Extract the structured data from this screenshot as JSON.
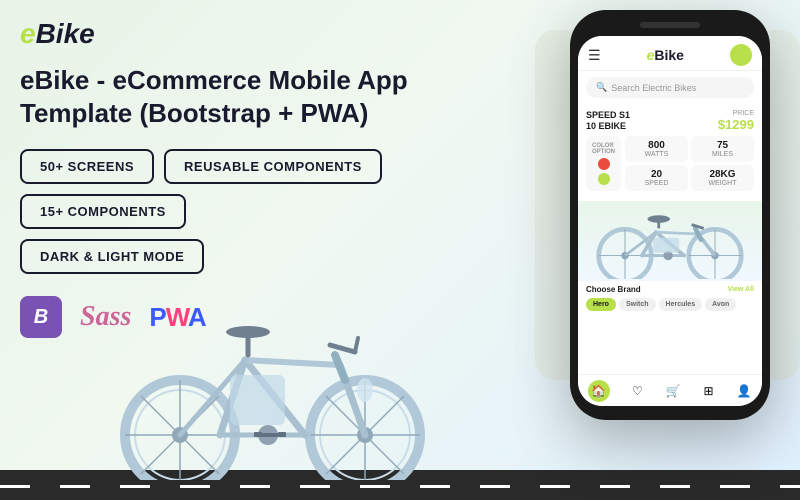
{
  "logo": {
    "e": "e",
    "bike": "Bike"
  },
  "title": "eBike - eCommerce Mobile App Template (Bootstrap + PWA)",
  "badges": [
    {
      "id": "screens",
      "label": "50+ SCREENS"
    },
    {
      "id": "components-reusable",
      "label": "REUSABLE COMPONENTS"
    },
    {
      "id": "components-count",
      "label": "15+ COMPONENTS"
    },
    {
      "id": "dark-light",
      "label": "DARK & LIGHT MODE"
    }
  ],
  "tech": {
    "bootstrap_label": "B",
    "sass_label": "Sass",
    "pwa_label": "PWA"
  },
  "app": {
    "name_e": "e",
    "name_bike": "Bike",
    "search_placeholder": "Search Electric Bikes",
    "product_name": "SPEED S1\n10 EBIKE",
    "price_label": "PRICE",
    "price_value": "$1299",
    "color_option_label": "COLOR\nOPTION",
    "watts_value": "800",
    "watts_label": "WATTS",
    "miles_value": "75",
    "miles_label": "MILES",
    "speed_value": "20",
    "speed_label": "SPEED",
    "weight_value": "28KG",
    "weight_label": "WEIGHT",
    "brand_section_title": "Choose Brand",
    "view_all": "View All",
    "brand_tabs": [
      "Hero",
      "Switch",
      "Hercules",
      "Avon"
    ],
    "active_brand": "Hero"
  },
  "colors": {
    "accent_green": "#b8e04a",
    "dark": "#1a1a2e",
    "bootstrap_purple": "#7952b3",
    "sass_pink": "#cc6699",
    "pwa_blue": "#3d5afe"
  }
}
